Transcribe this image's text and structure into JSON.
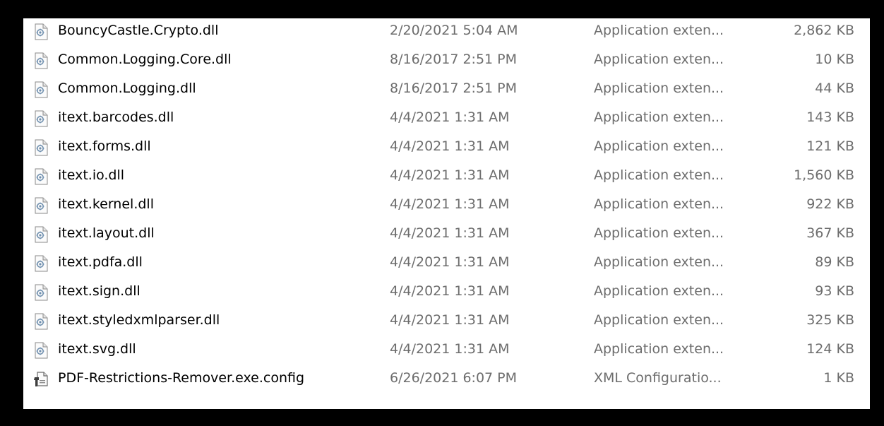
{
  "colors": {
    "background": "#000000",
    "pane": "#ffffff",
    "name_text": "#000000",
    "meta_text": "#6d6d6d"
  },
  "files": [
    {
      "name": "BouncyCastle.Crypto.dll",
      "date": "2/20/2021 5:04 AM",
      "type": "Application exten...",
      "size": "2,862 KB",
      "icon": "dll-file-icon"
    },
    {
      "name": "Common.Logging.Core.dll",
      "date": "8/16/2017 2:51 PM",
      "type": "Application exten...",
      "size": "10 KB",
      "icon": "dll-file-icon"
    },
    {
      "name": "Common.Logging.dll",
      "date": "8/16/2017 2:51 PM",
      "type": "Application exten...",
      "size": "44 KB",
      "icon": "dll-file-icon"
    },
    {
      "name": "itext.barcodes.dll",
      "date": "4/4/2021 1:31 AM",
      "type": "Application exten...",
      "size": "143 KB",
      "icon": "dll-file-icon"
    },
    {
      "name": "itext.forms.dll",
      "date": "4/4/2021 1:31 AM",
      "type": "Application exten...",
      "size": "121 KB",
      "icon": "dll-file-icon"
    },
    {
      "name": "itext.io.dll",
      "date": "4/4/2021 1:31 AM",
      "type": "Application exten...",
      "size": "1,560 KB",
      "icon": "dll-file-icon"
    },
    {
      "name": "itext.kernel.dll",
      "date": "4/4/2021 1:31 AM",
      "type": "Application exten...",
      "size": "922 KB",
      "icon": "dll-file-icon"
    },
    {
      "name": "itext.layout.dll",
      "date": "4/4/2021 1:31 AM",
      "type": "Application exten...",
      "size": "367 KB",
      "icon": "dll-file-icon"
    },
    {
      "name": "itext.pdfa.dll",
      "date": "4/4/2021 1:31 AM",
      "type": "Application exten...",
      "size": "89 KB",
      "icon": "dll-file-icon"
    },
    {
      "name": "itext.sign.dll",
      "date": "4/4/2021 1:31 AM",
      "type": "Application exten...",
      "size": "93 KB",
      "icon": "dll-file-icon"
    },
    {
      "name": "itext.styledxmlparser.dll",
      "date": "4/4/2021 1:31 AM",
      "type": "Application exten...",
      "size": "325 KB",
      "icon": "dll-file-icon"
    },
    {
      "name": "itext.svg.dll",
      "date": "4/4/2021 1:31 AM",
      "type": "Application exten...",
      "size": "124 KB",
      "icon": "dll-file-icon"
    },
    {
      "name": "PDF-Restrictions-Remover.exe.config",
      "date": "6/26/2021 6:07 PM",
      "type": "XML Configuratio...",
      "size": "1 KB",
      "icon": "config-file-icon"
    }
  ]
}
